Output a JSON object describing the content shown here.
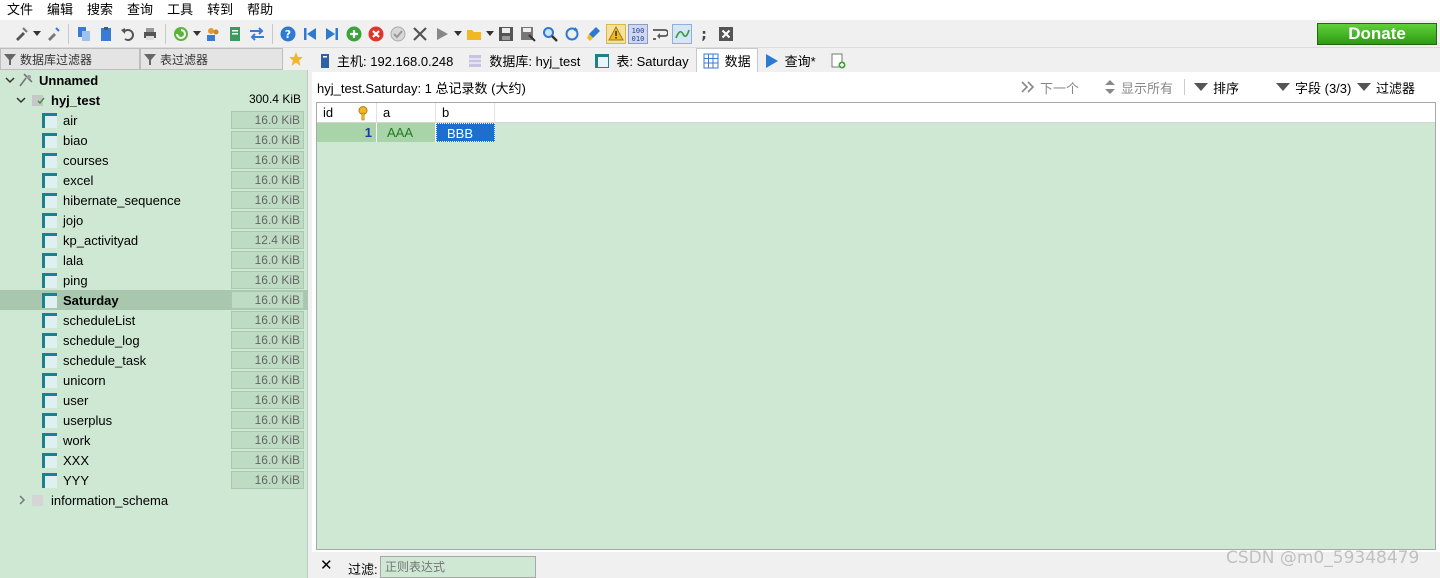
{
  "menu": [
    "文件",
    "编辑",
    "搜索",
    "查询",
    "工具",
    "转到",
    "帮助"
  ],
  "donate_label": "Donate",
  "left_filters": {
    "db_filter": "数据库过滤器",
    "table_filter": "表过滤器"
  },
  "tree": {
    "session": "Unnamed",
    "database": {
      "name": "hyj_test",
      "size": "300.4 KiB"
    },
    "tables": [
      {
        "name": "air",
        "size": "16.0 KiB"
      },
      {
        "name": "biao",
        "size": "16.0 KiB"
      },
      {
        "name": "courses",
        "size": "16.0 KiB"
      },
      {
        "name": "excel",
        "size": "16.0 KiB"
      },
      {
        "name": "hibernate_sequence",
        "size": "16.0 KiB"
      },
      {
        "name": "jojo",
        "size": "16.0 KiB"
      },
      {
        "name": "kp_activityad",
        "size": "12.4 KiB"
      },
      {
        "name": "lala",
        "size": "16.0 KiB"
      },
      {
        "name": "ping",
        "size": "16.0 KiB"
      },
      {
        "name": "Saturday",
        "size": "16.0 KiB"
      },
      {
        "name": "scheduleList",
        "size": "16.0 KiB"
      },
      {
        "name": "schedule_log",
        "size": "16.0 KiB"
      },
      {
        "name": "schedule_task",
        "size": "16.0 KiB"
      },
      {
        "name": "unicorn",
        "size": "16.0 KiB"
      },
      {
        "name": "user",
        "size": "16.0 KiB"
      },
      {
        "name": "userplus",
        "size": "16.0 KiB"
      },
      {
        "name": "work",
        "size": "16.0 KiB"
      },
      {
        "name": "XXX",
        "size": "16.0 KiB"
      },
      {
        "name": "YYY",
        "size": "16.0 KiB"
      }
    ],
    "other_database": "information_schema"
  },
  "tabs": [
    {
      "label": "主机: 192.168.0.248"
    },
    {
      "label": "数据库: hyj_test"
    },
    {
      "label": "表: Saturday"
    },
    {
      "label": "数据"
    },
    {
      "label": "查询*"
    }
  ],
  "infobar": {
    "title": "hyj_test.Saturday: 1 总记录数 (大约)",
    "next": "下一个",
    "show_all": "显示所有",
    "sort": "排序",
    "fields": "字段 (3/3)",
    "filter": "过滤器"
  },
  "grid": {
    "columns": [
      "id",
      "a",
      "b"
    ],
    "rows": [
      [
        "1",
        "AAA",
        "BBB"
      ]
    ]
  },
  "bottom": {
    "label": "过滤:",
    "placeholder": "正则表达式"
  },
  "watermark": "CSDN @m0_59348479"
}
